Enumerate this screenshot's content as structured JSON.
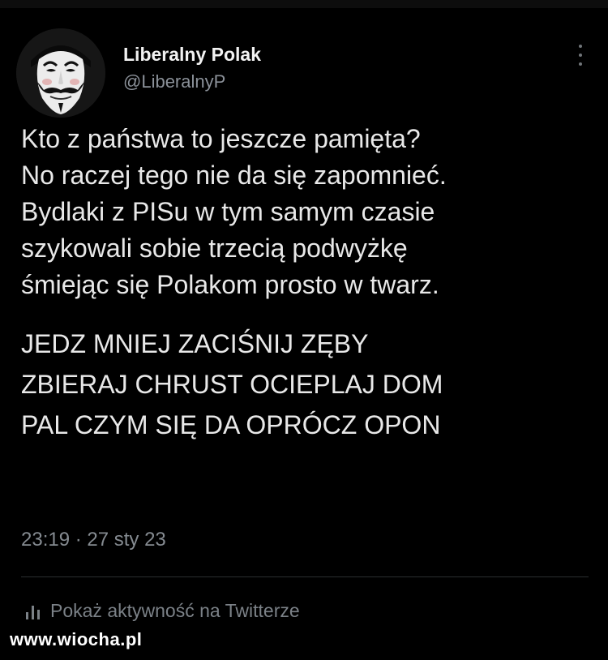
{
  "tweet": {
    "author": {
      "display_name": "Liberalny Polak",
      "handle": "@LiberalnyP",
      "avatar_icon": "guy-fawkes-mask-icon"
    },
    "text_lines": [
      "Kto z państwa to jeszcze pamięta?",
      "No raczej tego nie da się zapomnieć.",
      "Bydlaki z PISu w tym samym czasie",
      "szykowali sobie trzecią podwyżkę",
      "śmiejąc się Polakom prosto w twarz."
    ],
    "text_lines_2": [
      "JEDZ MNIEJ ZACIŚNIJ ZĘBY",
      "ZBIERAJ CHRUST OCIEPLAJ DOM",
      "PAL CZYM SIĘ DA OPRÓCZ OPON"
    ],
    "timestamp": "23:19 · 27 sty 23",
    "activity_label": "Pokaż aktywność na Twitterze"
  },
  "watermark": "www.wiocha.pl",
  "colors": {
    "background": "#000000",
    "primary_text": "#e8e8e8",
    "secondary_text": "#858b91"
  }
}
